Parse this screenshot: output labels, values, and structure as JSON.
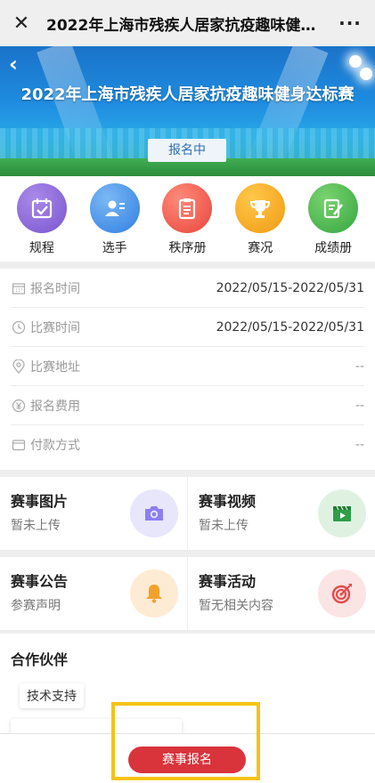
{
  "navbar": {
    "close": "✕",
    "title": "2022年上海市残疾人居家抗疫趣味健身达标赛",
    "more": "···"
  },
  "banner": {
    "back": "‹",
    "title": "2022年上海市残疾人居家抗疫趣味健身达标赛",
    "status": "报名中"
  },
  "menu": {
    "items": [
      {
        "label": "规程",
        "icon": "calendar-check-icon",
        "color": "#8a68d6"
      },
      {
        "label": "选手",
        "icon": "id-card-icon",
        "color": "#3f8fe8"
      },
      {
        "label": "秩序册",
        "icon": "clipboard-icon",
        "color": "#f0564b"
      },
      {
        "label": "赛况",
        "icon": "trophy-icon",
        "color": "#f5a51a"
      },
      {
        "label": "成绩册",
        "icon": "edit-doc-icon",
        "color": "#43b54b"
      }
    ]
  },
  "info": {
    "rows": [
      {
        "label": "报名时间",
        "value": "2022/05/15-2022/05/31",
        "icon": "calendar-icon"
      },
      {
        "label": "比赛时间",
        "value": "2022/05/15-2022/05/31",
        "icon": "clock-icon"
      },
      {
        "label": "比赛地址",
        "value": "--",
        "icon": "location-icon"
      },
      {
        "label": "报名费用",
        "value": "--",
        "icon": "yen-icon"
      },
      {
        "label": "付款方式",
        "value": "--",
        "icon": "wallet-icon"
      }
    ]
  },
  "cards": {
    "photos": {
      "title": "赛事图片",
      "sub": "暂未上传",
      "icon": "camera-icon"
    },
    "videos": {
      "title": "赛事视频",
      "sub": "暂未上传",
      "icon": "video-icon"
    },
    "notice": {
      "title": "赛事公告",
      "sub": "参赛声明",
      "icon": "bell-icon"
    },
    "activity": {
      "title": "赛事活动",
      "sub": "暂无相关内容",
      "icon": "target-icon"
    }
  },
  "partners": {
    "title": "合作伙伴",
    "tag": "技术支持"
  },
  "bottom": {
    "signup": "赛事报名"
  },
  "colors": {
    "accent_red": "#d9343c",
    "highlight": "#f5c316"
  }
}
